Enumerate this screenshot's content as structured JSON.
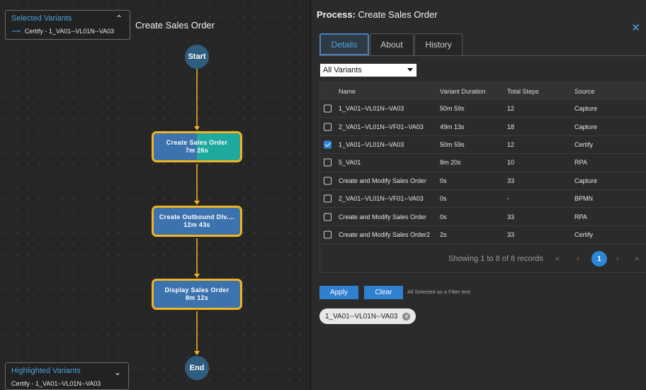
{
  "flow": {
    "title": "Create Sales Order",
    "start_label": "Start",
    "end_label": "End",
    "steps": [
      {
        "name": "Create Sales Order",
        "duration": "7m 26s"
      },
      {
        "name": "Create Outbound Dlv....",
        "duration": "12m 43s"
      },
      {
        "name": "Display Sales Order",
        "duration": "8m 12s"
      }
    ],
    "edge_color": "#f0b323"
  },
  "selected_variants": {
    "title": "Selected Variants",
    "item": "Certify - 1_VA01--VL01N--VA03"
  },
  "highlighted_variants": {
    "title": "Highlighted Variants",
    "item": "Certify - 1_VA01--VL01N--VA03"
  },
  "panel": {
    "title_prefix": "Process:",
    "title": "Create Sales Order",
    "tabs": [
      {
        "label": "Details",
        "active": true
      },
      {
        "label": "About",
        "active": false
      },
      {
        "label": "History",
        "active": false
      }
    ],
    "variant_filter": "All Variants",
    "table": {
      "columns": [
        "Name",
        "Variant Duration",
        "Total Steps",
        "Source"
      ],
      "rows": [
        {
          "checked": false,
          "name": "1_VA01--VL01N--VA03",
          "duration": "50m 59s",
          "steps": "12",
          "source": "Capture"
        },
        {
          "checked": false,
          "name": "2_VA01--VL01N--VF01--VA03",
          "duration": "49m 13s",
          "steps": "18",
          "source": "Capture"
        },
        {
          "checked": true,
          "name": "1_VA01--VL01N--VA03",
          "duration": "50m 59s",
          "steps": "12",
          "source": "Certify"
        },
        {
          "checked": false,
          "name": "5_VA01",
          "duration": "8m 20s",
          "steps": "10",
          "source": "RPA"
        },
        {
          "checked": false,
          "name": "Create and Modify Sales Order",
          "duration": "0s",
          "steps": "33",
          "source": "Capture"
        },
        {
          "checked": false,
          "name": "2_VA01--VL01N--VF01--VA03",
          "duration": "0s",
          "steps": "-",
          "source": "BPMN"
        },
        {
          "checked": false,
          "name": "Create and Modify Sales Order",
          "duration": "0s",
          "steps": "33",
          "source": "RPA"
        },
        {
          "checked": false,
          "name": "Create and Modify Sales Order2",
          "duration": "2s",
          "steps": "33",
          "source": "Certify"
        }
      ]
    },
    "pager": {
      "showing": "Showing 1 to 8 of 8 records",
      "current_page": "1"
    },
    "apply_label": "Apply",
    "clear_label": "Clear",
    "filter_note": "All Selected as a Filter test",
    "chip_label": "1_VA01--VL01N--VA03"
  }
}
